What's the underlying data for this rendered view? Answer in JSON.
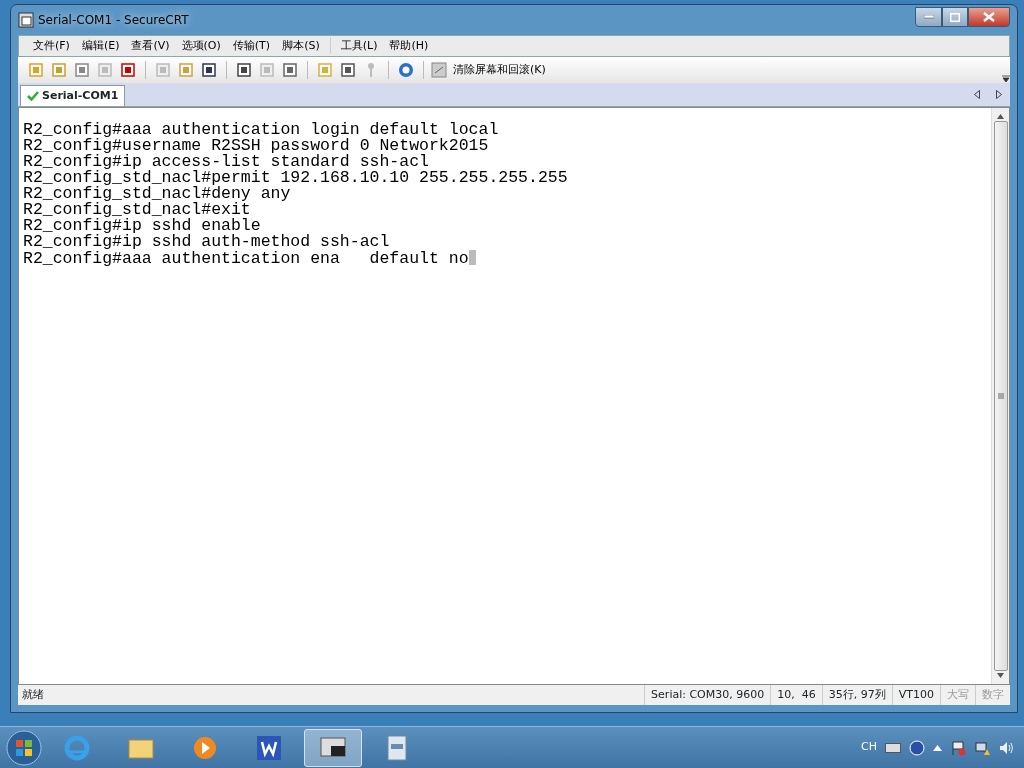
{
  "window": {
    "title": "Serial-COM1 - SecureCRT"
  },
  "menu": [
    "文件(F)",
    "编辑(E)",
    "查看(V)",
    "选项(O)",
    "传输(T)",
    "脚本(S)",
    "工具(L)",
    "帮助(H)"
  ],
  "toolbar": [
    {
      "kind": "icon",
      "disabled": false
    },
    {
      "kind": "icon",
      "disabled": false
    },
    {
      "kind": "icon",
      "disabled": false
    },
    {
      "kind": "icon",
      "disabled": true
    },
    {
      "kind": "icon",
      "disabled": false
    },
    {
      "kind": "separator"
    },
    {
      "kind": "icon",
      "disabled": true
    },
    {
      "kind": "icon",
      "disabled": false
    },
    {
      "kind": "icon",
      "disabled": false
    },
    {
      "kind": "separator"
    },
    {
      "kind": "icon",
      "disabled": false
    },
    {
      "kind": "icon",
      "disabled": true
    },
    {
      "kind": "icon",
      "disabled": false
    },
    {
      "kind": "separator"
    },
    {
      "kind": "icon",
      "disabled": false
    },
    {
      "kind": "icon",
      "disabled": false
    },
    {
      "kind": "icon",
      "disabled": true
    },
    {
      "kind": "separator"
    },
    {
      "kind": "icon",
      "disabled": false
    },
    {
      "kind": "separator"
    },
    {
      "kind": "button",
      "label": "清除屏幕和回滚(K)"
    }
  ],
  "tabs": [
    {
      "label": "Serial-COM1",
      "selected": true
    }
  ],
  "terminal": {
    "lines": [
      "R2_config#aaa authentication login default local",
      "R2_config#username R2SSH password 0 Network2015",
      "R2_config#ip access-list standard ssh-acl",
      "R2_config_std_nacl#permit 192.168.10.10 255.255.255.255",
      "R2_config_std_nacl#deny any",
      "R2_config_std_nacl#exit",
      "R2_config#ip sshd enable",
      "R2_config#ip sshd auth-method ssh-acl",
      "R2_config#aaa authentication ena   default no"
    ]
  },
  "status_bar": {
    "message": "就绪",
    "panes": [
      {
        "text": "Serial: COM30, 9600",
        "disabled": false
      },
      {
        "text": "10,  46",
        "disabled": false
      },
      {
        "text": "35行, 97列",
        "disabled": false
      },
      {
        "text": "VT100",
        "disabled": false
      },
      {
        "text": "大写",
        "disabled": true
      },
      {
        "text": "数字",
        "disabled": true
      }
    ]
  },
  "taskbar": {
    "apps": [
      {
        "selected": false
      },
      {
        "selected": false
      },
      {
        "selected": false
      },
      {
        "selected": false
      },
      {
        "selected": true
      },
      {
        "selected": false
      }
    ],
    "tray": {
      "language": "CH"
    }
  }
}
